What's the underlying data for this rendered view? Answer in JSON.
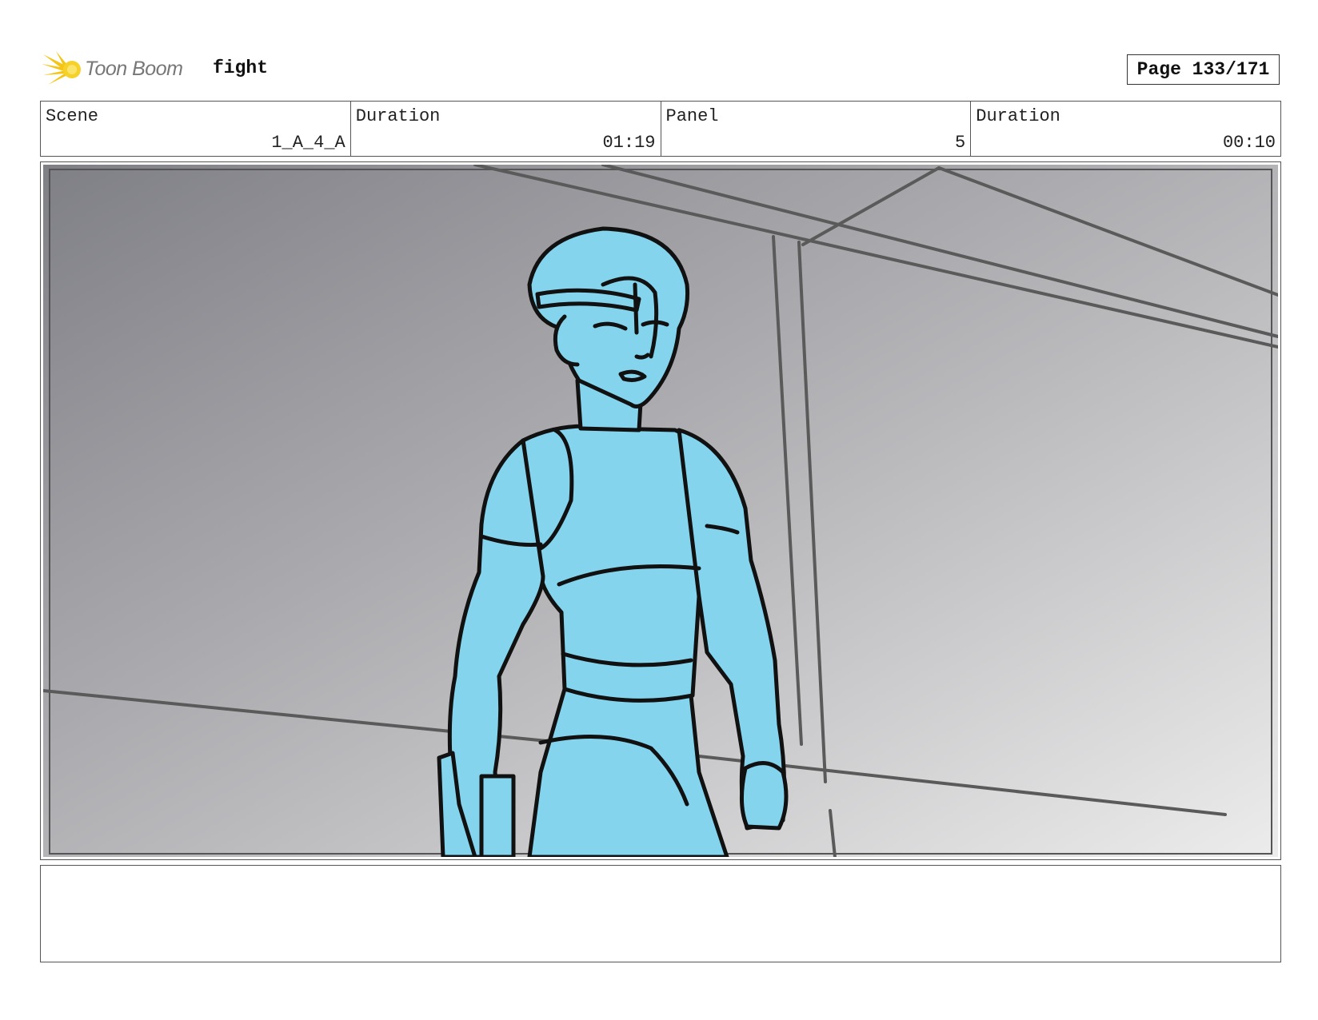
{
  "header": {
    "logo_text": "Toon Boom",
    "project_title": "fight",
    "page_label": "Page 133/171"
  },
  "info": {
    "scene_label": "Scene",
    "scene_value": "1_A_4_A",
    "scene_duration_label": "Duration",
    "scene_duration_value": "01:19",
    "panel_label": "Panel",
    "panel_value": "5",
    "panel_duration_label": "Duration",
    "panel_duration_value": "00:10"
  },
  "panel": {
    "figure_fill": "#84D4EE",
    "line_color": "#111111",
    "background_dark": "#8a8a90",
    "background_light": "#e6e6e6"
  },
  "notes": {
    "text": ""
  }
}
